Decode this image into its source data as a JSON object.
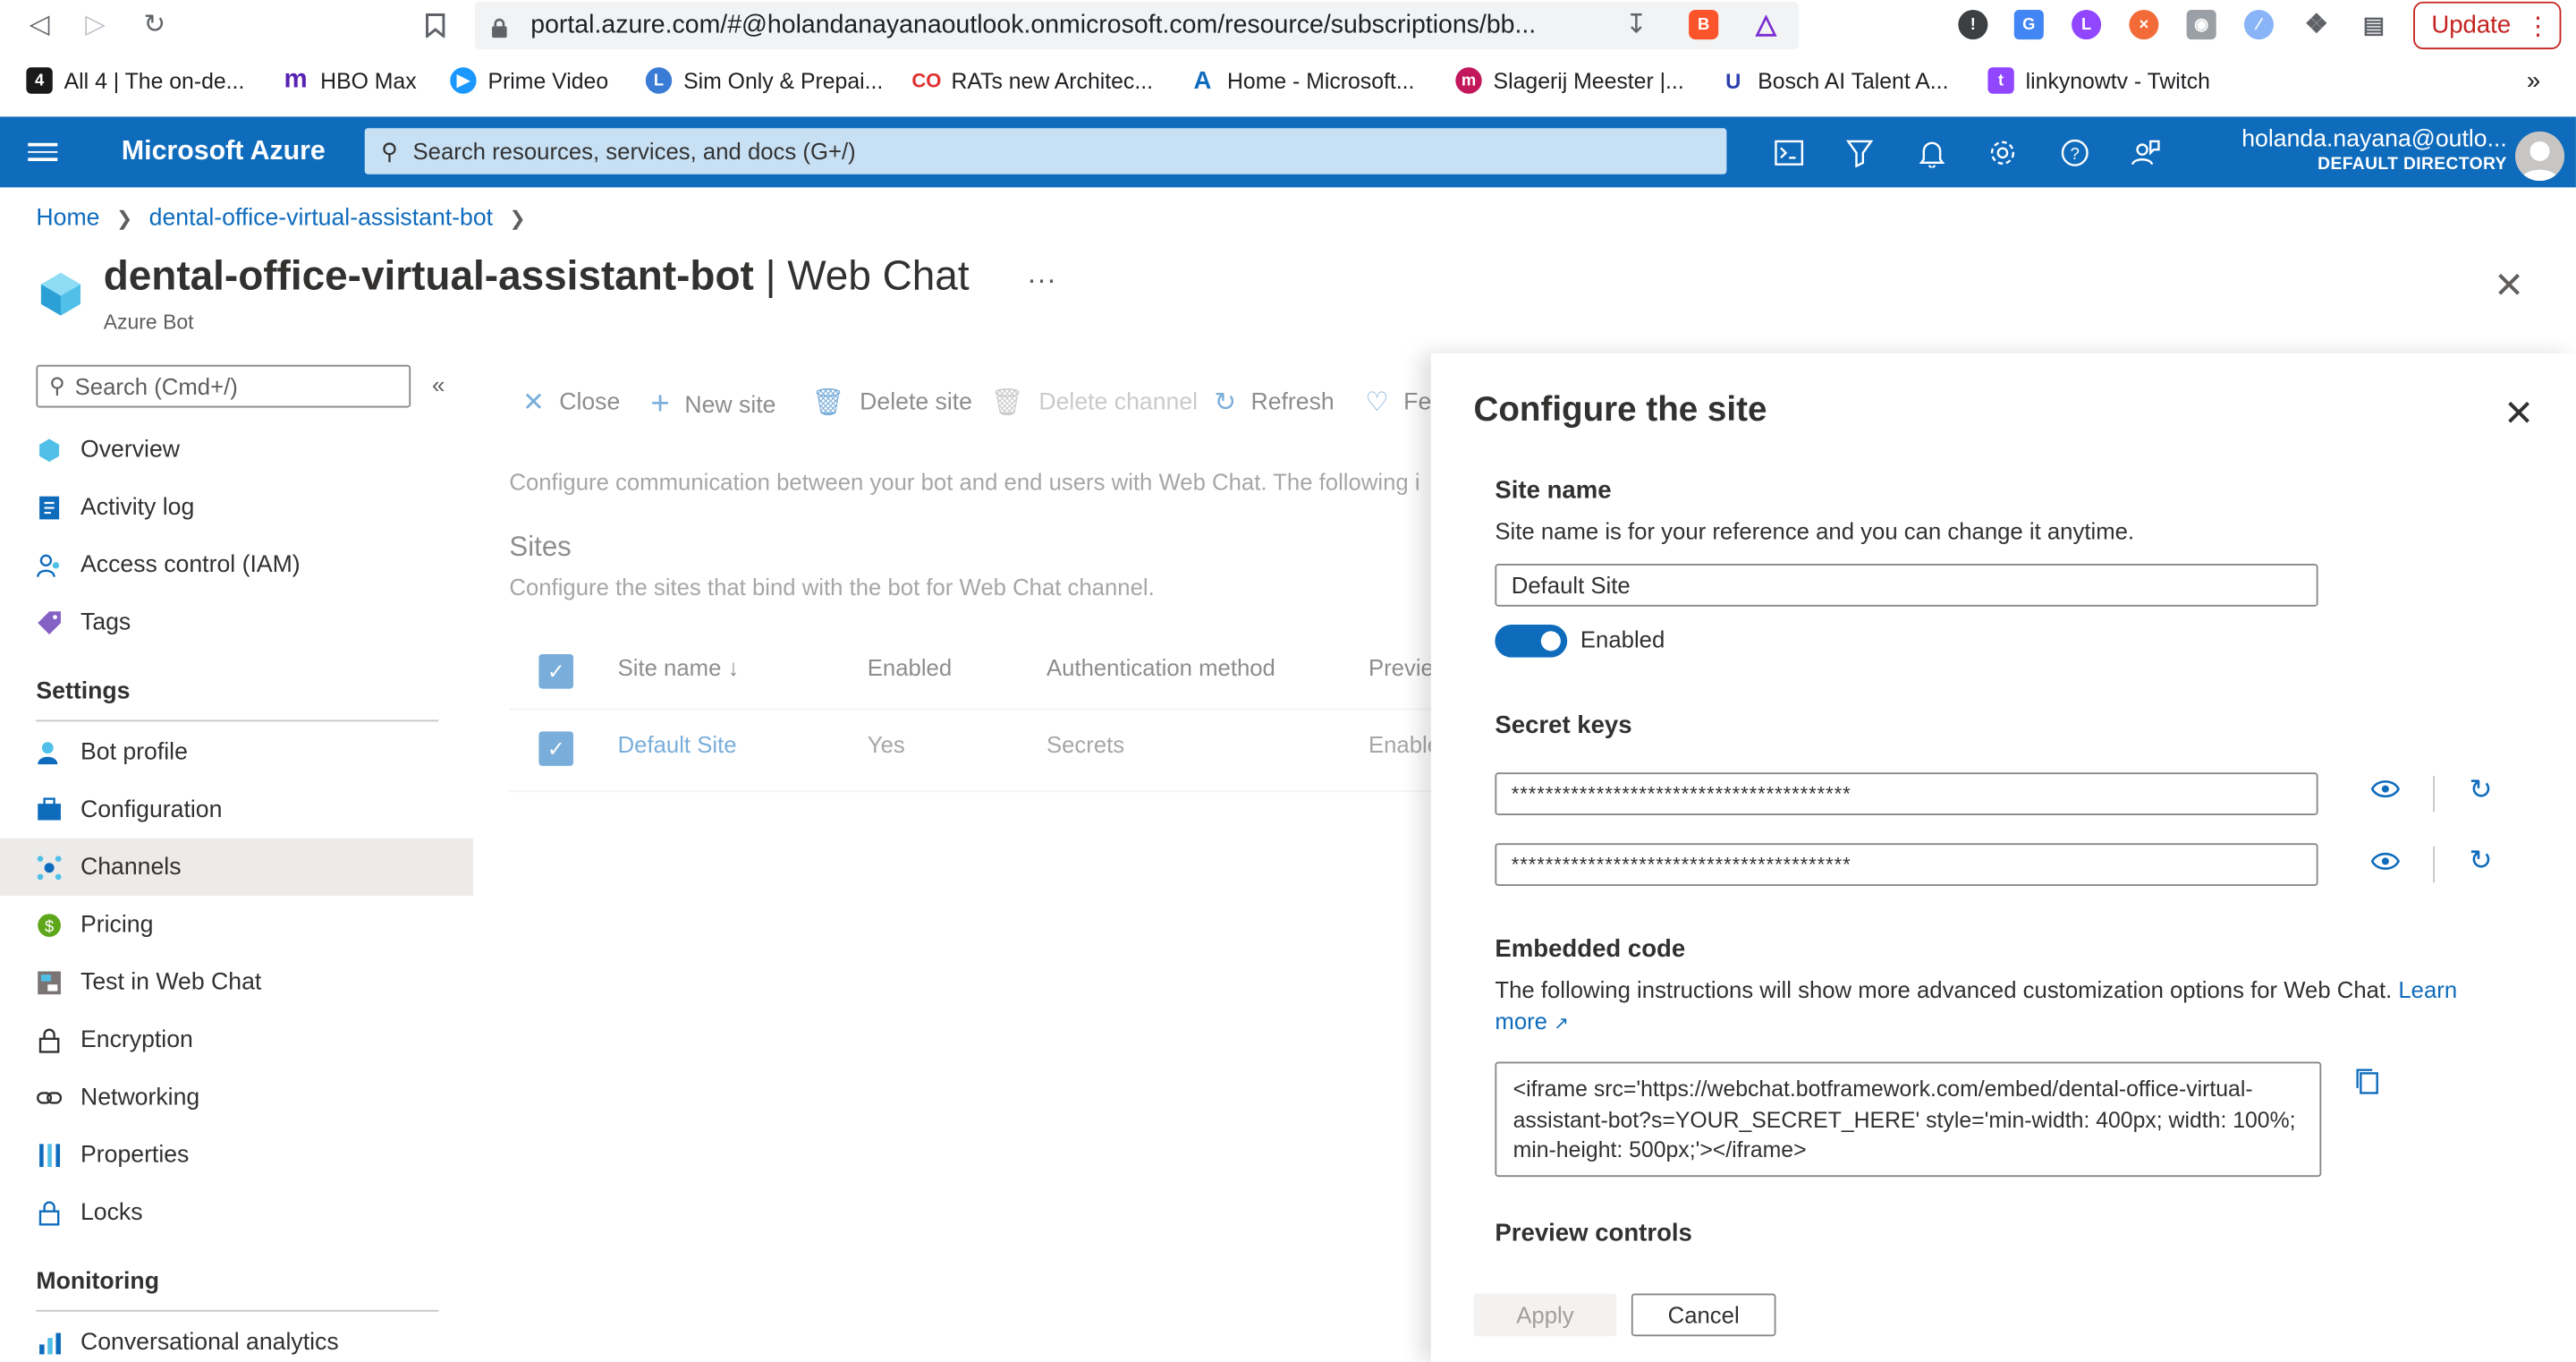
{
  "browser": {
    "url": "portal.azure.com/#@holandanayanaoutlook.onmicrosoft.com/resource/subscriptions/bb...",
    "update_label": "Update",
    "bookmarks": [
      {
        "label": "All 4 | The on-de...",
        "icon": "all4-icon",
        "color": "#1a1a1a"
      },
      {
        "label": "HBO Max",
        "icon": "hbo-max-icon",
        "color": "#5822b4"
      },
      {
        "label": "Prime Video",
        "icon": "prime-video-icon",
        "color": "#1a98ff"
      },
      {
        "label": "Sim Only & Prepai...",
        "icon": "sim-only-icon",
        "color": "#3a7bd5"
      },
      {
        "label": "RATs new Architec...",
        "icon": "rats-icon",
        "color": "#e03131"
      },
      {
        "label": "Home - Microsoft...",
        "icon": "azure-icon",
        "color": "#0f6cbd"
      },
      {
        "label": "Slagerij Meester |...",
        "icon": "slagerij-icon",
        "color": "#c2185b"
      },
      {
        "label": "Bosch AI Talent A...",
        "icon": "udacity-icon",
        "color": "#2d3fb0"
      },
      {
        "label": "linkynowtv - Twitch",
        "icon": "twitch-icon",
        "color": "#9146ff"
      }
    ]
  },
  "topbar": {
    "brand": "Microsoft Azure",
    "search_placeholder": "Search resources, services, and docs (G+/)",
    "user_name": "holanda.nayana@outlo...",
    "directory": "DEFAULT DIRECTORY"
  },
  "breadcrumb": {
    "home": "Home",
    "resource": "dental-office-virtual-assistant-bot"
  },
  "header": {
    "title": "dental-office-virtual-assistant-bot",
    "title_suffix": "| Web Chat",
    "subtitle": "Azure Bot"
  },
  "nav": {
    "search_placeholder": "Search (Cmd+/)",
    "items": [
      {
        "label": "Overview"
      },
      {
        "label": "Activity log"
      },
      {
        "label": "Access control (IAM)"
      },
      {
        "label": "Tags"
      }
    ],
    "settings_heading": "Settings",
    "settings_items": [
      {
        "label": "Bot profile"
      },
      {
        "label": "Configuration"
      },
      {
        "label": "Channels"
      },
      {
        "label": "Pricing"
      },
      {
        "label": "Test in Web Chat"
      },
      {
        "label": "Encryption"
      },
      {
        "label": "Networking"
      },
      {
        "label": "Properties"
      },
      {
        "label": "Locks"
      }
    ],
    "monitoring_heading": "Monitoring",
    "monitoring_items": [
      {
        "label": "Conversational analytics"
      }
    ]
  },
  "blade": {
    "commands": {
      "close": "Close",
      "new_site": "New site",
      "delete_site": "Delete site",
      "delete_channel": "Delete channel",
      "refresh": "Refresh",
      "feedback": "Fe"
    },
    "description": "Configure communication between your bot and end users with Web Chat. The following i",
    "sites_heading": "Sites",
    "sites_description": "Configure the sites that bind with the bot for Web Chat channel.",
    "columns": [
      "Site name ↓",
      "Enabled",
      "Authentication method",
      "Previe"
    ],
    "rows": [
      {
        "site_name": "Default Site",
        "enabled": "Yes",
        "auth": "Secrets",
        "preview": "Enable"
      }
    ]
  },
  "panel": {
    "title": "Configure the site",
    "site_name_heading": "Site name",
    "site_name_help": "Site name is for your reference and you can change it anytime.",
    "site_name_value": "Default Site",
    "enabled_label": "Enabled",
    "secret_keys_heading": "Secret keys",
    "secret_key_1": "****************************************",
    "secret_key_2": "****************************************",
    "embedded_heading": "Embedded code",
    "embedded_help": "The following instructions will show more advanced customization options for Web Chat.",
    "learn_more_1": "Learn",
    "learn_more_2": "more",
    "embed_code": "<iframe src='https://webchat.botframework.com/embed/dental-office-virtual-assistant-bot?s=YOUR_SECRET_HERE'  style='min-width: 400px; width: 100%; min-height: 500px;'></iframe>",
    "preview_heading": "Preview controls",
    "apply_label": "Apply",
    "cancel_label": "Cancel"
  },
  "colors": {
    "azure_blue": "#0f6cbd",
    "search_bg": "#c7e0f4",
    "active_nav": "#edebe9"
  }
}
